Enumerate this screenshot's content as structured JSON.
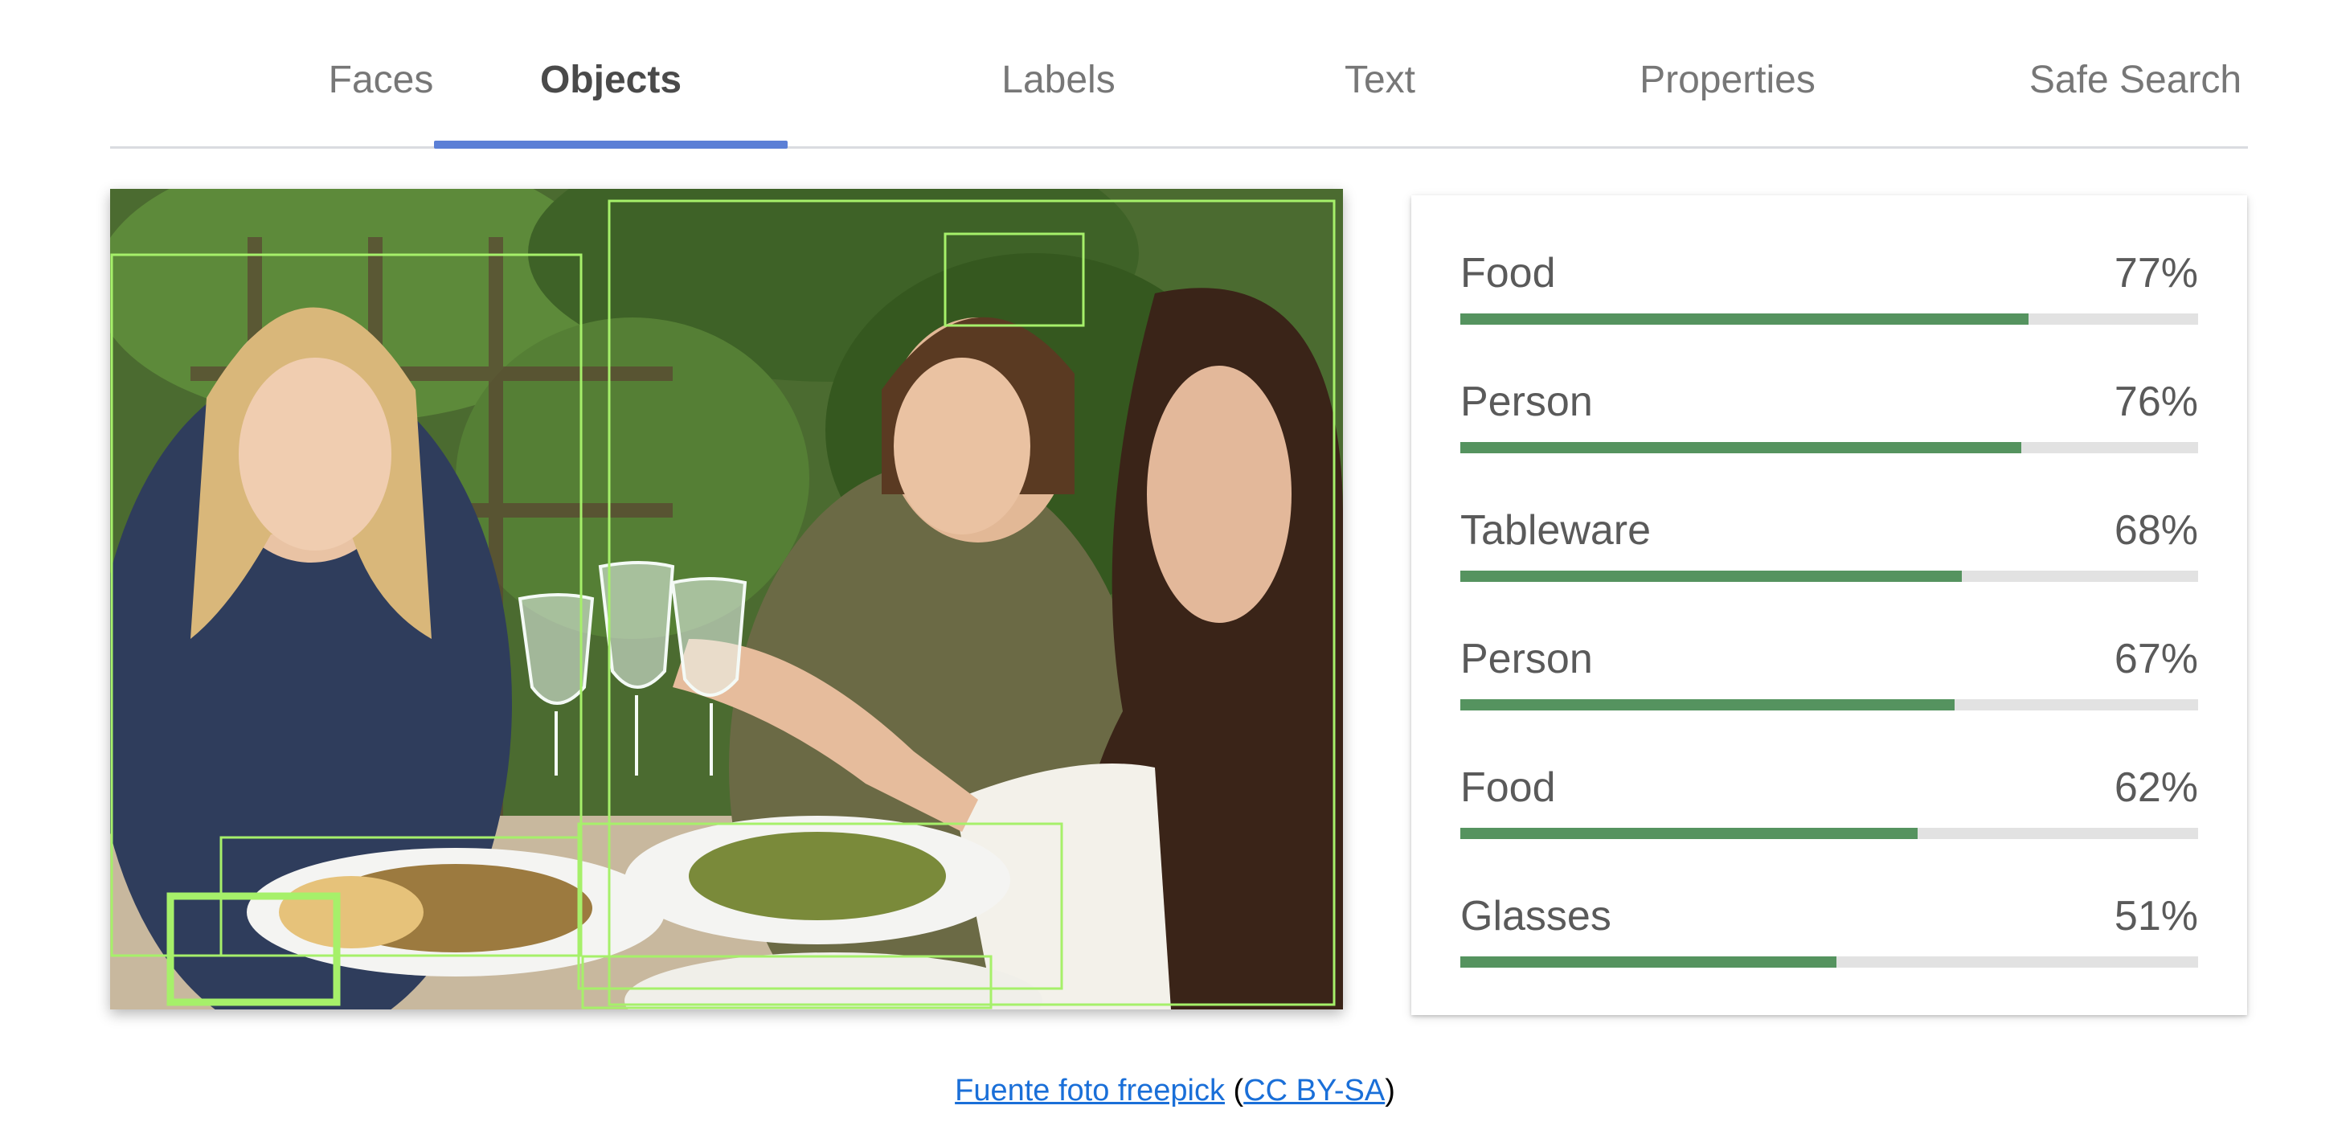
{
  "tabs": [
    {
      "label": "Faces",
      "active": false
    },
    {
      "label": "Objects",
      "active": true
    },
    {
      "label": "Labels",
      "active": false
    },
    {
      "label": "Text",
      "active": false
    },
    {
      "label": "Properties",
      "active": false
    },
    {
      "label": "Safe Search",
      "active": false
    }
  ],
  "photo": {
    "bounding_box_color": "#a6f06a"
  },
  "results": [
    {
      "label": "Food",
      "percent_text": "77%",
      "score": 0.77
    },
    {
      "label": "Person",
      "percent_text": "76%",
      "score": 0.76
    },
    {
      "label": "Tableware",
      "percent_text": "68%",
      "score": 0.68
    },
    {
      "label": "Person",
      "percent_text": "67%",
      "score": 0.67
    },
    {
      "label": "Food",
      "percent_text": "62%",
      "score": 0.62
    },
    {
      "label": "Glasses",
      "percent_text": "51%",
      "score": 0.51
    }
  ],
  "colors": {
    "bar_fill": "#55935f",
    "bar_track": "#e2e2e2",
    "tab_indicator": "#5b7fd6",
    "link": "#1a6fd8"
  },
  "credit": {
    "source_link": "Fuente foto freepick",
    "open_paren": "(",
    "license_link": "CC BY-SA",
    "close_paren": ")"
  }
}
